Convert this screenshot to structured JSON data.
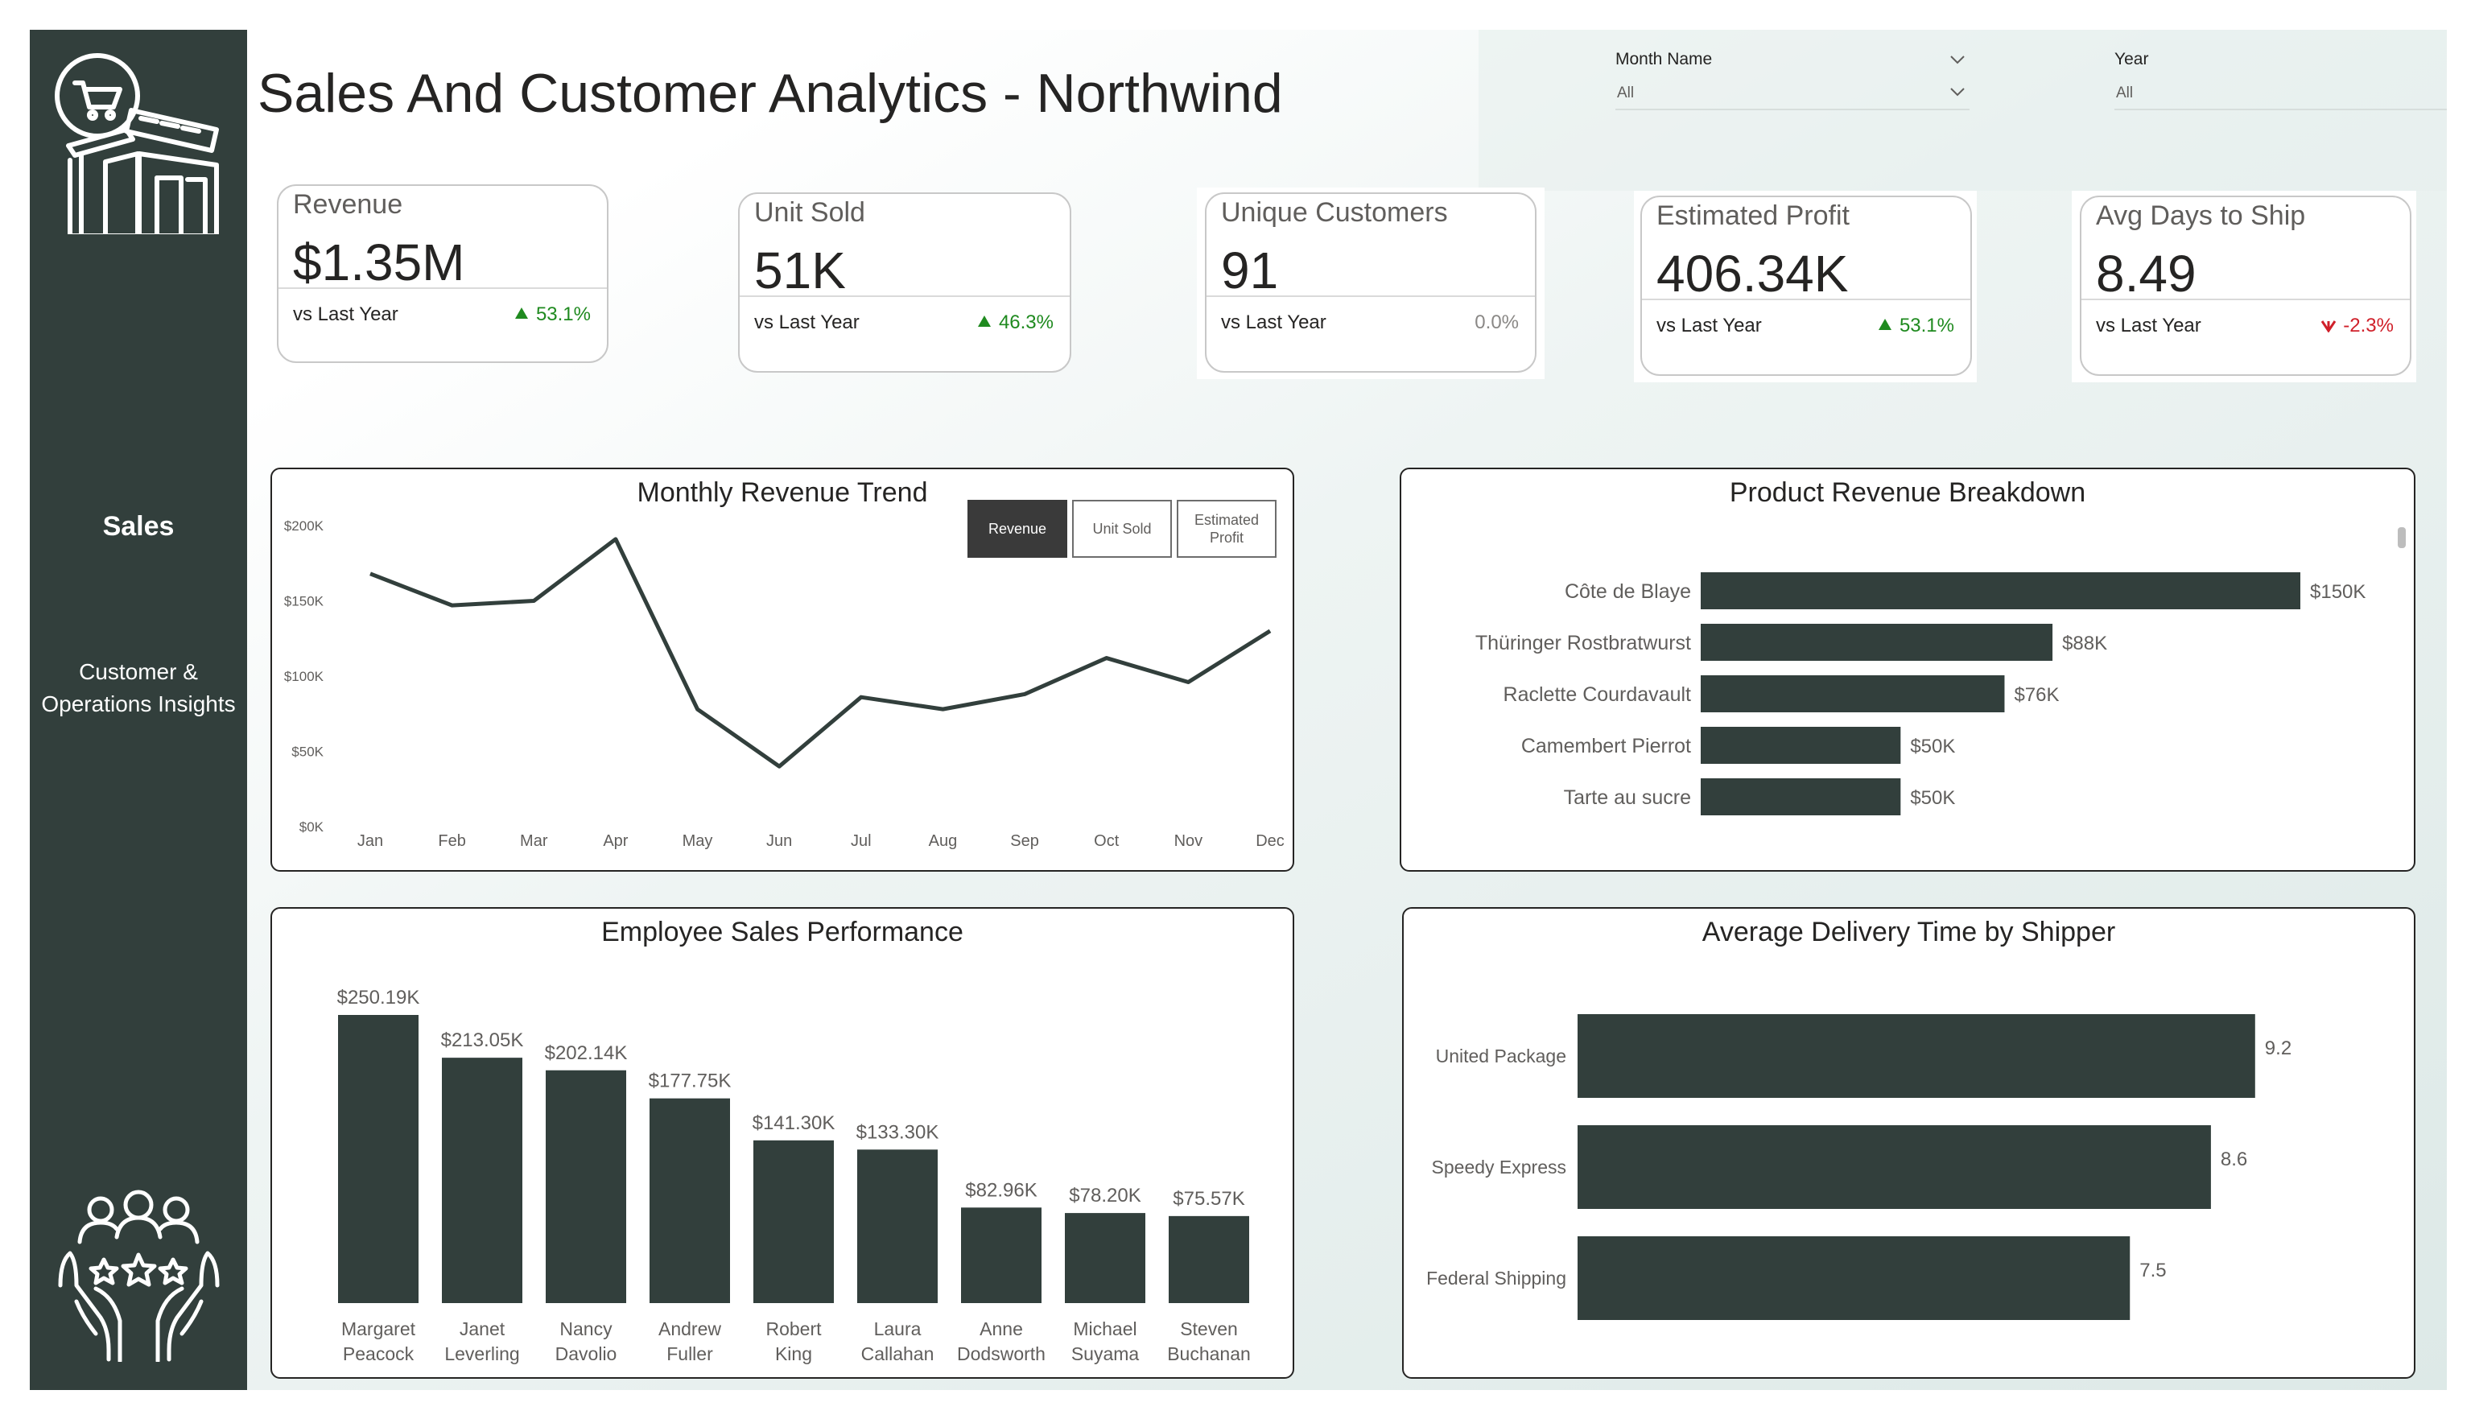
{
  "title": "Sales And Customer Analytics - Northwind",
  "sidebar": {
    "logo_icon": "store-cart-icon",
    "bottom_icon": "customer-rating-hands-icon",
    "items": [
      {
        "label": "Sales",
        "active": true
      },
      {
        "label_line1": "Customer &",
        "label_line2": "Operations Insights"
      }
    ]
  },
  "filters": {
    "month": {
      "label": "Month Name",
      "value": "All"
    },
    "year": {
      "label": "Year",
      "value": "All"
    }
  },
  "kpis": [
    {
      "title": "Revenue",
      "value": "$1.35M",
      "sub": "vs Last Year",
      "change": "53.1%",
      "trend": "up"
    },
    {
      "title": "Unit Sold",
      "value": "51K",
      "sub": "vs Last Year",
      "change": "46.3%",
      "trend": "up"
    },
    {
      "title": "Unique Customers",
      "value": "91",
      "sub": "vs Last Year",
      "change": "0.0%",
      "trend": "flat"
    },
    {
      "title": "Estimated Profit",
      "value": "406.34K",
      "sub": "vs Last Year",
      "change": "53.1%",
      "trend": "up"
    },
    {
      "title": "Avg Days to Ship",
      "value": "8.49",
      "sub": "vs Last Year",
      "change": "-2.3%",
      "trend": "down"
    }
  ],
  "monthly_trend": {
    "title": "Monthly Revenue Trend",
    "toggles": [
      {
        "label": "Revenue",
        "active": true
      },
      {
        "label": "Unit Sold",
        "active": false
      },
      {
        "label_line1": "Estimated",
        "label_line2": "Profit",
        "active": false
      }
    ]
  },
  "product_breakdown": {
    "title": "Product Revenue Breakdown"
  },
  "employee_performance": {
    "title": "Employee Sales Performance"
  },
  "delivery_time": {
    "title": "Average Delivery Time by Shipper"
  },
  "colors": {
    "bar": "#323f3c",
    "sidebar": "#323f3c",
    "positive": "#1f8a1f",
    "negative": "#d0202a"
  },
  "chart_data": [
    {
      "id": "monthly",
      "type": "line",
      "title": "Monthly Revenue Trend",
      "x": [
        "Jan",
        "Feb",
        "Mar",
        "Apr",
        "May",
        "Jun",
        "Jul",
        "Aug",
        "Sep",
        "Oct",
        "Nov",
        "Dec"
      ],
      "values": [
        168000,
        147000,
        150000,
        191000,
        78000,
        40000,
        86000,
        78000,
        88000,
        112000,
        96000,
        130000
      ],
      "y_ticks": [
        "$0K",
        "$50K",
        "$100K",
        "$150K",
        "$200K"
      ],
      "ylim": [
        0,
        200000
      ],
      "grid": false
    },
    {
      "id": "product",
      "type": "bar",
      "orientation": "horizontal",
      "title": "Product Revenue Breakdown",
      "categories": [
        "Côte de Blaye",
        "Thüringer Rostbratwurst",
        "Raclette Courdavault",
        "Camembert Pierrot",
        "Tarte au sucre"
      ],
      "values": [
        150000,
        88000,
        76000,
        50000,
        50000
      ],
      "labels": [
        "$150K",
        "$88K",
        "$76K",
        "$50K",
        "$50K"
      ]
    },
    {
      "id": "employee",
      "type": "bar",
      "title": "Employee Sales Performance",
      "categories": [
        [
          "Margaret",
          "Peacock"
        ],
        [
          "Janet",
          "Leverling"
        ],
        [
          "Nancy",
          "Davolio"
        ],
        [
          "Andrew",
          "Fuller"
        ],
        [
          "Robert",
          "King"
        ],
        [
          "Laura",
          "Callahan"
        ],
        [
          "Anne",
          "Dodsworth"
        ],
        [
          "Michael",
          "Suyama"
        ],
        [
          "Steven",
          "Buchanan"
        ]
      ],
      "values": [
        250190,
        213050,
        202140,
        177750,
        141300,
        133300,
        82960,
        78200,
        75570
      ],
      "labels": [
        "$250.19K",
        "$213.05K",
        "$202.14K",
        "$177.75K",
        "$141.30K",
        "$133.30K",
        "$82.96K",
        "$78.20K",
        "$75.57K"
      ]
    },
    {
      "id": "delivery",
      "type": "bar",
      "orientation": "horizontal",
      "title": "Average Delivery Time by Shipper",
      "categories": [
        "United Package",
        "Speedy Express",
        "Federal Shipping"
      ],
      "values": [
        9.2,
        8.6,
        7.5
      ],
      "labels": [
        "9.2",
        "8.6",
        "7.5"
      ]
    }
  ]
}
